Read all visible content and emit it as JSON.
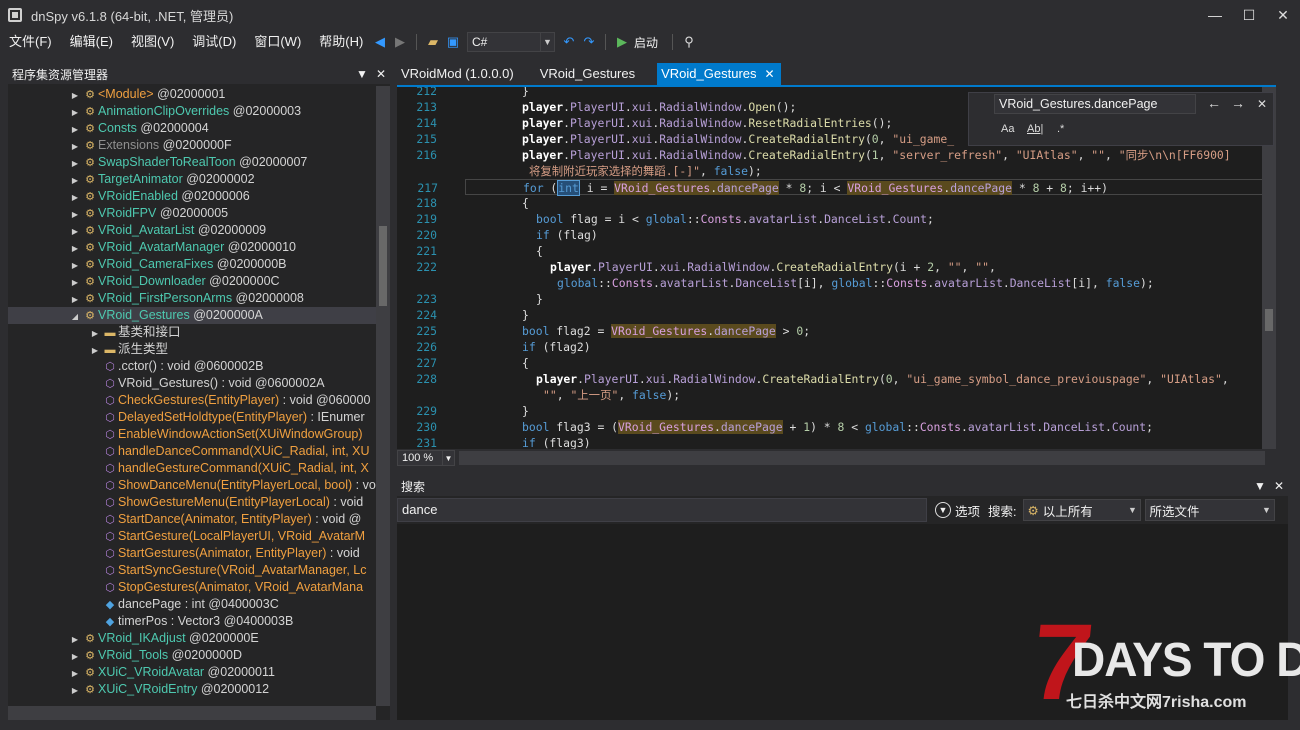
{
  "window": {
    "title": "dnSpy v6.1.8 (64-bit, .NET, 管理员)",
    "min_glyph": "—",
    "max_glyph": "☐",
    "close_glyph": "✕"
  },
  "menu": [
    "文件(F)",
    "编辑(E)",
    "视图(V)",
    "调试(D)",
    "窗口(W)",
    "帮助(H)"
  ],
  "toolbar": {
    "language": "C#",
    "start_label": "启动"
  },
  "assembly_explorer": {
    "title": "程序集资源管理器",
    "items": [
      {
        "exp": "▶",
        "ic": "⚙",
        "name": "<Module>",
        "suffix": " @02000001",
        "color": "orange",
        "indent": 0
      },
      {
        "exp": "▶",
        "ic": "⚙",
        "name": "AnimationClipOverrides",
        "suffix": " @02000003",
        "color": "type",
        "indent": 0
      },
      {
        "exp": "▶",
        "ic": "⚙",
        "name": "Consts",
        "suffix": " @02000004",
        "color": "type",
        "indent": 0
      },
      {
        "exp": "▶",
        "ic": "⚙",
        "name": "Extensions",
        "suffix": " @0200000F",
        "color": "gray",
        "indent": 0
      },
      {
        "exp": "▶",
        "ic": "⚙",
        "name": "SwapShaderToRealToon",
        "suffix": " @02000007",
        "color": "type",
        "indent": 0
      },
      {
        "exp": "▶",
        "ic": "⚙",
        "name": "TargetAnimator",
        "suffix": " @02000002",
        "color": "type",
        "indent": 0
      },
      {
        "exp": "▶",
        "ic": "⚙",
        "name": "VRoidEnabled",
        "suffix": " @02000006",
        "color": "type",
        "indent": 0
      },
      {
        "exp": "▶",
        "ic": "⚙",
        "name": "VRoidFPV",
        "suffix": " @02000005",
        "color": "type",
        "indent": 0
      },
      {
        "exp": "▶",
        "ic": "⚙",
        "name": "VRoid_AvatarList",
        "suffix": " @02000009",
        "color": "type",
        "indent": 0
      },
      {
        "exp": "▶",
        "ic": "⚙",
        "name": "VRoid_AvatarManager",
        "suffix": " @02000010",
        "color": "type",
        "indent": 0
      },
      {
        "exp": "▶",
        "ic": "⚙",
        "name": "VRoid_CameraFixes",
        "suffix": " @0200000B",
        "color": "type",
        "indent": 0
      },
      {
        "exp": "▶",
        "ic": "⚙",
        "name": "VRoid_Downloader",
        "suffix": " @0200000C",
        "color": "type",
        "indent": 0
      },
      {
        "exp": "▶",
        "ic": "⚙",
        "name": "VRoid_FirstPersonArms",
        "suffix": " @02000008",
        "color": "type",
        "indent": 0
      },
      {
        "exp": "◢",
        "ic": "⚙",
        "name": "VRoid_Gestures",
        "suffix": " @0200000A",
        "color": "type",
        "indent": 0,
        "selected": true
      },
      {
        "exp": "▶",
        "ic": "▬",
        "name": "基类和接口",
        "suffix": "",
        "color": "def",
        "indent": 1
      },
      {
        "exp": "▶",
        "ic": "▬",
        "name": "派生类型",
        "suffix": "",
        "color": "def",
        "indent": 1
      },
      {
        "exp": "",
        "ic": "⬡",
        "name": ".cctor()",
        "suffix": " : void @0600002B",
        "color": "def",
        "indent": 1
      },
      {
        "exp": "",
        "ic": "⬡",
        "name": "VRoid_Gestures()",
        "suffix": " : void @0600002A",
        "color": "def",
        "indent": 1
      },
      {
        "exp": "",
        "ic": "⬡",
        "name": "CheckGestures(EntityPlayer)",
        "suffix": " : void @060000",
        "color": "orange",
        "indent": 1
      },
      {
        "exp": "",
        "ic": "⬡",
        "name": "DelayedSetHoldtype(EntityPlayer)",
        "suffix": " : IEnumer",
        "color": "orange",
        "indent": 1
      },
      {
        "exp": "",
        "ic": "⬡",
        "name": "EnableWindowActionSet(XUiWindowGroup)",
        "suffix": "",
        "color": "orange",
        "indent": 1
      },
      {
        "exp": "",
        "ic": "⬡",
        "name": "handleDanceCommand(XUiC_Radial, int, XU",
        "suffix": "",
        "color": "orange",
        "indent": 1
      },
      {
        "exp": "",
        "ic": "⬡",
        "name": "handleGestureCommand(XUiC_Radial, int, X",
        "suffix": "",
        "color": "orange",
        "indent": 1
      },
      {
        "exp": "",
        "ic": "⬡",
        "name": "ShowDanceMenu(EntityPlayerLocal, bool)",
        "suffix": " : vo",
        "color": "orange",
        "indent": 1
      },
      {
        "exp": "",
        "ic": "⬡",
        "name": "ShowGestureMenu(EntityPlayerLocal)",
        "suffix": " : void",
        "color": "orange",
        "indent": 1
      },
      {
        "exp": "",
        "ic": "⬡",
        "name": "StartDance(Animator, EntityPlayer)",
        "suffix": " : void @",
        "color": "orange",
        "indent": 1
      },
      {
        "exp": "",
        "ic": "⬡",
        "name": "StartGesture(LocalPlayerUI, VRoid_AvatarM",
        "suffix": "",
        "color": "orange",
        "indent": 1
      },
      {
        "exp": "",
        "ic": "⬡",
        "name": "StartGestures(Animator, EntityPlayer)",
        "suffix": " : void",
        "color": "orange",
        "indent": 1
      },
      {
        "exp": "",
        "ic": "⬡",
        "name": "StartSyncGesture(VRoid_AvatarManager, Lc",
        "suffix": "",
        "color": "orange",
        "indent": 1
      },
      {
        "exp": "",
        "ic": "⬡",
        "name": "StopGestures(Animator, VRoid_AvatarMana",
        "suffix": "",
        "color": "orange",
        "indent": 1
      },
      {
        "exp": "",
        "ic": "◆",
        "name": "dancePage",
        "suffix": " : int @0400003C",
        "color": "def",
        "indent": 1
      },
      {
        "exp": "",
        "ic": "◆",
        "name": "timerPos",
        "suffix": " : Vector3 @0400003B",
        "color": "def",
        "indent": 1
      },
      {
        "exp": "▶",
        "ic": "⚙",
        "name": "VRoid_IKAdjust",
        "suffix": " @0200000E",
        "color": "type",
        "indent": 0
      },
      {
        "exp": "▶",
        "ic": "⚙",
        "name": "VRoid_Tools",
        "suffix": " @0200000D",
        "color": "type",
        "indent": 0
      },
      {
        "exp": "▶",
        "ic": "⚙",
        "name": "XUiC_VRoidAvatar",
        "suffix": " @02000011",
        "color": "type",
        "indent": 0
      },
      {
        "exp": "▶",
        "ic": "⚙",
        "name": "XUiC_VRoidEntry",
        "suffix": " @02000012",
        "color": "type",
        "indent": 0
      }
    ]
  },
  "tabs": [
    {
      "label": "VRoidMod (1.0.0.0)",
      "active": false
    },
    {
      "label": "VRoid_Gestures",
      "active": false
    },
    {
      "label": "VRoid_Gestures",
      "active": true
    }
  ],
  "code_lines": [
    {
      "n": "212",
      "indent": 7,
      "html": "}"
    },
    {
      "n": "213",
      "indent": 7,
      "html": "<span class='bold'>player</span>.<span class='fld'>PlayerUI</span>.<span class='fld'>xui</span>.<span class='fld'>RadialWindow</span>.<span class='mth'>Open</span>();"
    },
    {
      "n": "214",
      "indent": 7,
      "html": "<span class='bold'>player</span>.<span class='fld'>PlayerUI</span>.<span class='fld'>xui</span>.<span class='fld'>RadialWindow</span>.<span class='mth'>ResetRadialEntries</span>();"
    },
    {
      "n": "215",
      "indent": 7,
      "html": "<span class='bold'>player</span>.<span class='fld'>PlayerUI</span>.<span class='fld'>xui</span>.<span class='fld'>RadialWindow</span>.<span class='mth'>CreateRadialEntry</span>(<span class='num'>0</span>, <span class='str'>\"ui_game_</span>"
    },
    {
      "n": "216",
      "indent": 7,
      "html": "<span class='bold'>player</span>.<span class='fld'>PlayerUI</span>.<span class='fld'>xui</span>.<span class='fld'>RadialWindow</span>.<span class='mth'>CreateRadialEntry</span>(<span class='num'>1</span>, <span class='str'>\"server_refresh\"</span>, <span class='str'>\"UIAtlas\"</span>, <span class='str'>\"\"</span>, <span class='str'>\"同步\\n\\n[FF6900]</span>"
    },
    {
      "n": "",
      "indent": 8,
      "html": "<span class='str'>将复制附近玩家选择的舞蹈.[-]\"</span>, <span class='kw'>false</span>);"
    },
    {
      "n": "217",
      "indent": 7,
      "current": true,
      "html": "<span class='kw'>for</span> (<span class='kw hl-int'>int</span> i = <span class='hl-ref'><span class='cls'>VRoid_Gestures</span>.<span class='fld'>dancePage</span></span> * <span class='num'>8</span>; i &lt; <span class='hl-ref'><span class='cls'>VRoid_Gestures</span>.<span class='fld'>dancePage</span></span> * <span class='num'>8</span> + <span class='num'>8</span>; i++)"
    },
    {
      "n": "218",
      "indent": 7,
      "html": "{"
    },
    {
      "n": "219",
      "indent": 9,
      "html": "<span class='kw'>bool</span> flag = i &lt; <span class='kw'>global</span>::<span class='cls'>Consts</span>.<span class='fld'>avatarList</span>.<span class='fld'>DanceList</span>.<span class='fld'>Count</span>;"
    },
    {
      "n": "220",
      "indent": 9,
      "html": "<span class='kw'>if</span> (flag)"
    },
    {
      "n": "221",
      "indent": 9,
      "html": "{"
    },
    {
      "n": "222",
      "indent": 11,
      "html": "<span class='bold'>player</span>.<span class='fld'>PlayerUI</span>.<span class='fld'>xui</span>.<span class='fld'>RadialWindow</span>.<span class='mth'>CreateRadialEntry</span>(i + <span class='num'>2</span>, <span class='str'>\"\"</span>, <span class='str'>\"\"</span>,"
    },
    {
      "n": "",
      "indent": 12,
      "html": "<span class='kw'>global</span>::<span class='cls'>Consts</span>.<span class='fld'>avatarList</span>.<span class='fld'>DanceList</span>[i], <span class='kw'>global</span>::<span class='cls'>Consts</span>.<span class='fld'>avatarList</span>.<span class='fld'>DanceList</span>[i], <span class='kw'>false</span>);"
    },
    {
      "n": "223",
      "indent": 9,
      "html": "}"
    },
    {
      "n": "224",
      "indent": 7,
      "html": "}"
    },
    {
      "n": "225",
      "indent": 7,
      "html": "<span class='kw'>bool</span> flag2 = <span class='hl-ref'><span class='cls'>VRoid_Gestures</span>.<span class='fld'>dancePage</span></span> &gt; <span class='num'>0</span>;"
    },
    {
      "n": "226",
      "indent": 7,
      "html": "<span class='kw'>if</span> (flag2)"
    },
    {
      "n": "227",
      "indent": 7,
      "html": "{"
    },
    {
      "n": "228",
      "indent": 9,
      "html": "<span class='bold'>player</span>.<span class='fld'>PlayerUI</span>.<span class='fld'>xui</span>.<span class='fld'>RadialWindow</span>.<span class='mth'>CreateRadialEntry</span>(<span class='num'>0</span>, <span class='str'>\"ui_game_symbol_dance_previouspage\"</span>, <span class='str'>\"UIAtlas\"</span>,"
    },
    {
      "n": "",
      "indent": 10,
      "html": "<span class='str'>\"\"</span>, <span class='str'>\"上一页\"</span>, <span class='kw'>false</span>);"
    },
    {
      "n": "229",
      "indent": 7,
      "html": "}"
    },
    {
      "n": "230",
      "indent": 7,
      "html": "<span class='kw'>bool</span> flag3 = (<span class='hl-ref'><span class='cls'>VRoid_Gestures</span>.<span class='fld'>dancePage</span></span> + <span class='num'>1</span>) * <span class='num'>8</span> &lt; <span class='kw'>global</span>::<span class='cls'>Consts</span>.<span class='fld'>avatarList</span>.<span class='fld'>DanceList</span>.<span class='fld'>Count</span>;"
    },
    {
      "n": "231",
      "indent": 7,
      "html": "<span class='kw'>if</span> (flag3)"
    },
    {
      "n": "232",
      "indent": 7,
      "html": "{"
    }
  ],
  "find": {
    "query": "VRoid_Gestures.dancePage",
    "match_case": "Aa",
    "whole_word": "Ab|",
    "regex": ".*"
  },
  "editor_zoom": "100 %",
  "search_panel": {
    "title": "搜索",
    "query": "dance",
    "options_label": "选项",
    "search_label": "搜索:",
    "scope": "以上所有",
    "files": "所选文件"
  },
  "watermark": {
    "seven": "7",
    "title": "DAYS TO DIE",
    "sub": "七日杀中文网7risha.com"
  },
  "colors": {
    "accent": "#007acc",
    "background": "#2d2d30",
    "editor_bg": "#1e1e1e",
    "panel_bg": "#252526",
    "watermark_red": "#c0151b"
  }
}
